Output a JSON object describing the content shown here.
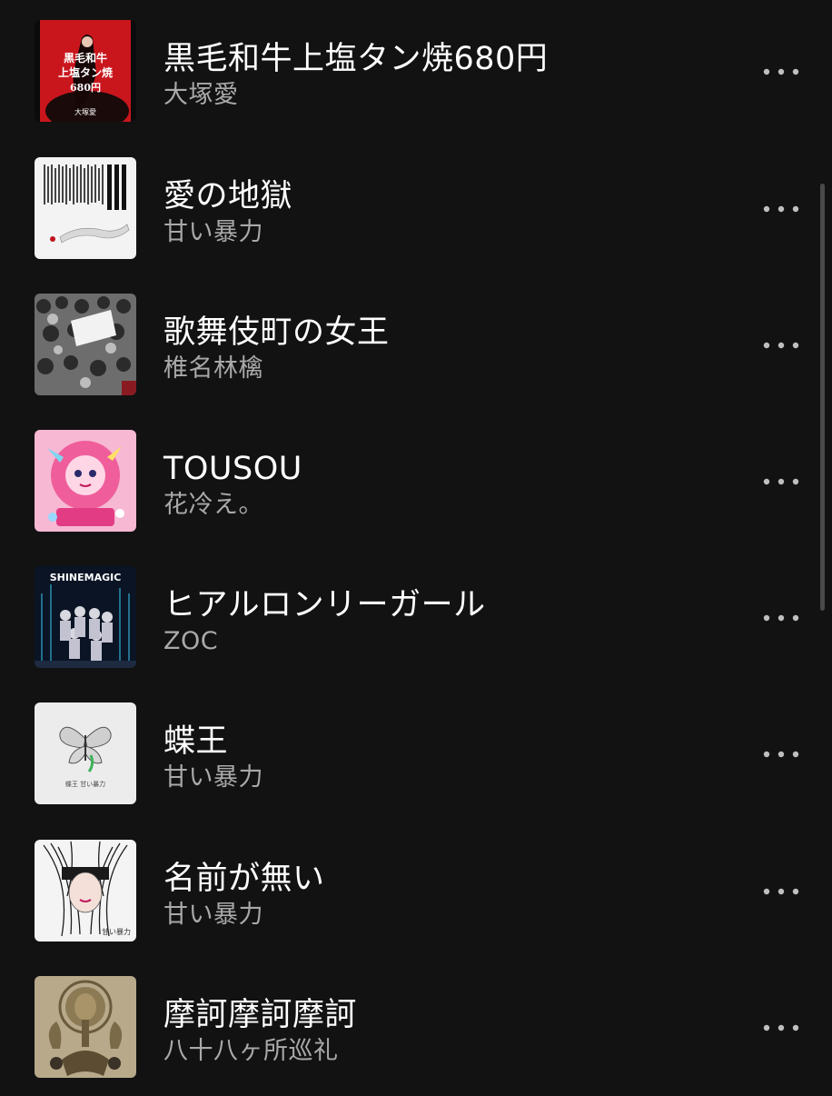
{
  "tracks": [
    {
      "title": "黒毛和牛上塩タン焼680円",
      "artist": "大塚愛",
      "art_icon": "album-art-black-red"
    },
    {
      "title": "愛の地獄",
      "artist": "甘い暴力",
      "art_icon": "album-art-white-text"
    },
    {
      "title": "歌舞伎町の女王",
      "artist": "椎名林檎",
      "art_icon": "album-art-crowd"
    },
    {
      "title": "TOUSOU",
      "artist": "花冷え。",
      "art_icon": "album-art-pink-anime"
    },
    {
      "title": "ヒアルロンリーガール",
      "artist": "ZOC",
      "art_icon": "album-art-shinemagic"
    },
    {
      "title": "蝶王",
      "artist": "甘い暴力",
      "art_icon": "album-art-butterfly"
    },
    {
      "title": "名前が無い",
      "artist": "甘い暴力",
      "art_icon": "album-art-hair-sketch"
    },
    {
      "title": "摩訶摩訶摩訶",
      "artist": "八十八ヶ所巡礼",
      "art_icon": "album-art-buddha"
    }
  ],
  "art_text": {
    "track0": [
      "黒毛和牛",
      "上塩タン焼",
      "680円",
      "大塚愛"
    ],
    "track4": "SHINEMAGIC",
    "track5": "蝶王  甘い暴力",
    "track6": "甘い暴力"
  },
  "colors": {
    "background": "#121212",
    "title": "#ffffff",
    "subtitle": "#a9a9a9",
    "more_icon": "#bfbfbf",
    "scrollbar": "#4a4a4a"
  },
  "icons": {
    "more": "more-horizontal-icon"
  }
}
